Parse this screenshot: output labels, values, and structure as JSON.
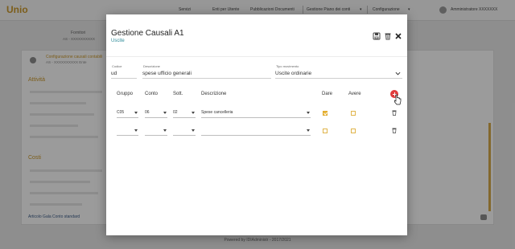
{
  "app": {
    "logo": "Unio",
    "nav": [
      "Servizi",
      "Enti per Utente",
      "Pubblicazioni Documenti",
      "Gestione Piano dei conti",
      "Configurazione"
    ],
    "nav_caret": "▾",
    "user": "Amministratore XXXXXXX",
    "bg_subtitle": "Fornitori",
    "bg_subtitle2": "AS - XXXXXXXXXX",
    "card_title": "Configurazione causali contabili",
    "card_subtitle": "AS - XXXXXXXXXX Ente",
    "section1": "Attività",
    "section2": "Costi",
    "bottom_links": "Articolo     Gala     Conto standard",
    "footer": "Powered by IDIAdministr - 2017/2021"
  },
  "modal": {
    "title": "Gestione Causali A1",
    "subtitle": "Uscite",
    "fields": {
      "codice_label": "Codice",
      "codice_value": "ud",
      "descrizione_label": "Descrizione",
      "descrizione_value": "spese ufficio generali",
      "tipo_label": "Tipo movimento",
      "tipo_value": "Uscite ordinarie"
    },
    "columns": {
      "gruppo": "Gruppo",
      "conto": "Conto",
      "sott": "Sott.",
      "descrizione": "Descrizione",
      "dare": "Dare",
      "avere": "Avere"
    },
    "rows": [
      {
        "gruppo": "C05",
        "conto": "06",
        "sott": "02",
        "descrizione": "Spese cancelleria",
        "dare": true,
        "avere": false
      },
      {
        "gruppo": "",
        "conto": "",
        "sott": "",
        "descrizione": "",
        "dare": false,
        "avere": false
      }
    ]
  },
  "colors": {
    "accent": "#e03c3c",
    "checkbox": "#e8b73c",
    "subtitle": "#2e8b9a",
    "brand": "#c8962a"
  },
  "icons": [
    "save-icon",
    "trash-icon",
    "close-icon",
    "add-row-icon",
    "chevron-down-icon",
    "cursor-icon"
  ]
}
